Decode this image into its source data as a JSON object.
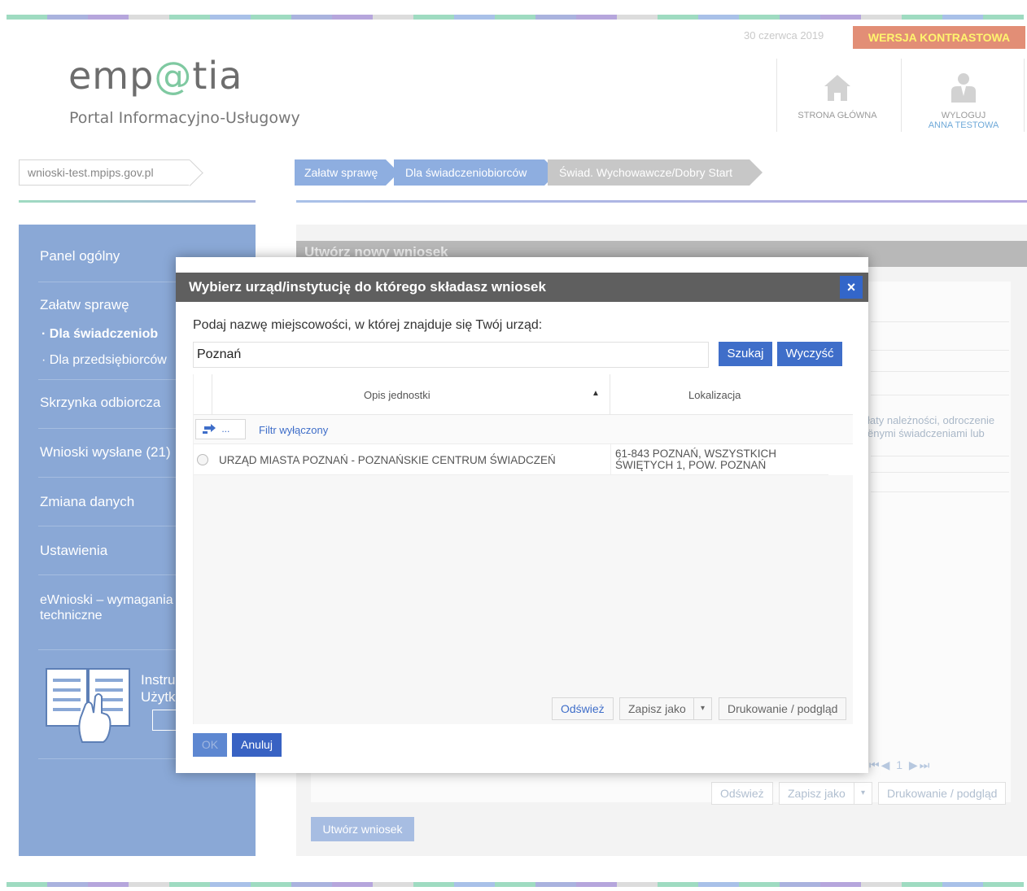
{
  "header": {
    "logo_left": "emp",
    "logo_at": "@",
    "logo_right": "tia",
    "subtitle": "Portal Informacyjno-Usługowy",
    "date": "30 czerwca 2019",
    "contrast_label": "WERSJA KONTRASTOWA",
    "home_label": "STRONA GŁÓWNA",
    "logout_label": "WYLOGUJ",
    "user_name": "ANNA TESTOWA"
  },
  "breadcrumbs": {
    "domain": "wnioski-test.mpips.gov.pl",
    "items": [
      "Załatw sprawę",
      "Dla świadczeniobiorców",
      "Świad. Wychowawcze/Dobry Start"
    ]
  },
  "sidebar": {
    "items": [
      "Panel ogólny",
      "Załatw sprawę",
      "Skrzynka odbiorcza",
      "Wnioski wysłane (21)",
      "Zmiana danych",
      "Ustawienia",
      "eWnioski – wymagania",
      "techniczne"
    ],
    "sub_items": [
      "Dla świadczeniob",
      "Dla przedsiębiorców"
    ],
    "guide_line1": "Instru",
    "guide_line2": "Użytk"
  },
  "background": {
    "panel_title": "Utwórz nowy wniosek",
    "snippet_line1": "łaty należności, odroczenie",
    "snippet_line2": "ënymi świadczeniami lub",
    "pager": "⏮◀  1  ▶⏭",
    "refresh": "Odśwież",
    "save_as": "Zapisz jako",
    "print": "Drukowanie / podgląd",
    "create_button": "Utwórz wniosek"
  },
  "modal": {
    "title": "Wybierz urząd/instytucję do którego składasz wniosek",
    "close": "×",
    "prompt": "Podaj nazwę miejscowości, w której znajduje się Twój urząd:",
    "city_value": "Poznań",
    "search_label": "Szukaj",
    "clear_label": "Wyczyść",
    "columns": [
      "Opis jednostki",
      "Lokalizacja"
    ],
    "filter_button": "...",
    "filter_label": "Filtr wyłączony",
    "rows": [
      {
        "name": "URZĄD MIASTA POZNAŃ - POZNAŃSKIE CENTRUM ŚWIADCZEŃ",
        "loc_line1": "61-843 POZNAŃ, WSZYSTKICH",
        "loc_line2": "ŚWIĘTYCH 1, POW. POZNAŃ"
      }
    ],
    "refresh": "Odśwież",
    "save_as": "Zapisz jako",
    "print": "Drukowanie / podgląd",
    "ok": "OK",
    "cancel": "Anuluj"
  },
  "colors": {
    "accent_blue": "#3f6ec9",
    "sidebar": "#8aa8d6",
    "contrast_bg": "#e28e76",
    "contrast_text": "#fff46e",
    "modal_header": "#5f5f5f"
  }
}
